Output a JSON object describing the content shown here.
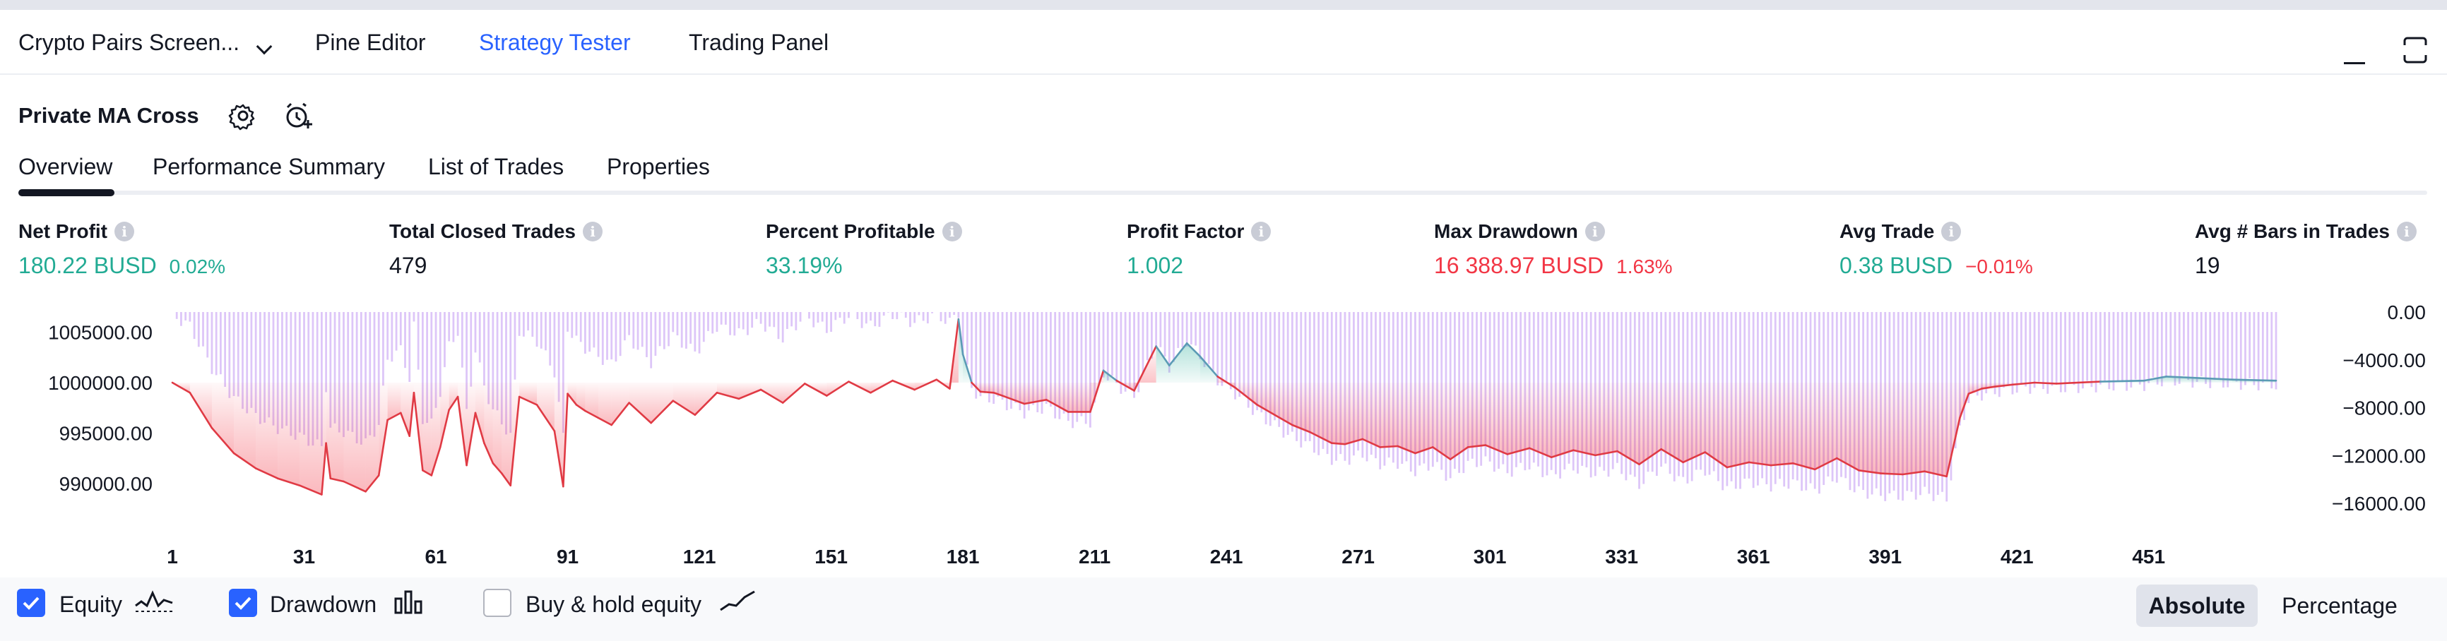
{
  "panel_tabs": [
    "Crypto Pairs Screen...",
    "Pine Editor",
    "Strategy Tester",
    "Trading Panel"
  ],
  "strategy": {
    "name": "Private MA Cross"
  },
  "subtabs": [
    "Overview",
    "Performance Summary",
    "List of Trades",
    "Properties"
  ],
  "metrics": [
    {
      "label": "Net Profit",
      "value": "180.22 BUSD",
      "sub": "0.02%",
      "color": "#22ab94",
      "sub_color": "#22ab94"
    },
    {
      "label": "Total Closed Trades",
      "value": "479",
      "sub": "",
      "color": "#131722",
      "sub_color": "#131722"
    },
    {
      "label": "Percent Profitable",
      "value": "33.19%",
      "sub": "",
      "color": "#22ab94",
      "sub_color": "#22ab94"
    },
    {
      "label": "Profit Factor",
      "value": "1.002",
      "sub": "",
      "color": "#22ab94",
      "sub_color": "#22ab94"
    },
    {
      "label": "Max Drawdown",
      "value": "16 388.97 BUSD",
      "sub": "1.63%",
      "color": "#f23645",
      "sub_color": "#f23645"
    },
    {
      "label": "Avg Trade",
      "value": "0.38 BUSD",
      "sub": "−0.01%",
      "color": "#22ab94",
      "sub_color": "#f23645"
    },
    {
      "label": "Avg # Bars in Trades",
      "value": "19",
      "sub": "",
      "color": "#131722",
      "sub_color": "#131722"
    }
  ],
  "chart_data": {
    "type": "line",
    "x_tick_labels": [
      "1",
      "31",
      "61",
      "91",
      "121",
      "151",
      "181",
      "211",
      "241",
      "271",
      "301",
      "331",
      "361",
      "391",
      "421",
      "451"
    ],
    "y_left_tick_labels": [
      "1005000.00",
      "1000000.00",
      "995000.00",
      "990000.00"
    ],
    "y_right_tick_labels": [
      "0.00",
      "−4000.00",
      "−8000.00",
      "−12000.00",
      "−16000.00"
    ],
    "y_left_range": [
      986000,
      1007000
    ],
    "y_right_range": [
      -17700,
      0
    ],
    "baseline_equity": 1000000,
    "series": [
      {
        "name": "Equity",
        "x": [
          1,
          5,
          10,
          15,
          20,
          25,
          30,
          35,
          36,
          37,
          40,
          45,
          48,
          50,
          53,
          55,
          56,
          58,
          60,
          62,
          64,
          66,
          68,
          70,
          72,
          74,
          76,
          78,
          80,
          84,
          88,
          90,
          91,
          93,
          95,
          98,
          101,
          105,
          110,
          115,
          120,
          125,
          130,
          135,
          140,
          145,
          150,
          155,
          160,
          165,
          170,
          175,
          178,
          180,
          181,
          183,
          185,
          188,
          190,
          195,
          200,
          205,
          210,
          213,
          216,
          220,
          225,
          228,
          232,
          235,
          239,
          243,
          248,
          252,
          256,
          260,
          265,
          268,
          272,
          276,
          280,
          284,
          288,
          292,
          296,
          300,
          305,
          310,
          315,
          320,
          325,
          330,
          335,
          340,
          345,
          350,
          355,
          360,
          365,
          370,
          375,
          380,
          385,
          390,
          395,
          400,
          405,
          408,
          410,
          413,
          416,
          420,
          425,
          430,
          440,
          450,
          455,
          460,
          470,
          480
        ],
        "values": [
          1000000,
          999000,
          995500,
          993000,
          991500,
          990500,
          989800,
          988900,
          994000,
          990500,
          990200,
          989200,
          990800,
          996300,
          997000,
          994700,
          999000,
          991300,
          990800,
          993600,
          997300,
          998600,
          991800,
          997000,
          994000,
          992000,
          991000,
          989800,
          998600,
          997800,
          995200,
          989700,
          998900,
          997800,
          997200,
          996500,
          995800,
          998000,
          996000,
          998200,
          996800,
          999000,
          998400,
          999300,
          998000,
          999900,
          998700,
          1000100,
          999000,
          1000200,
          999300,
          1000300,
          999400,
          1006300,
          1002800,
          1000000,
          999100,
          999000,
          998700,
          997900,
          998300,
          997100,
          997100,
          1001200,
          1000200,
          999200,
          1003600,
          1001700,
          1003900,
          1002600,
          1000600,
          999500,
          997800,
          996800,
          995800,
          995100,
          994000,
          993900,
          994400,
          993600,
          993700,
          993000,
          993600,
          992400,
          993600,
          993800,
          992900,
          993500,
          992600,
          993300,
          992800,
          993200,
          991900,
          993400,
          992100,
          993100,
          991600,
          992100,
          991800,
          992000,
          991400,
          992500,
          991300,
          991000,
          990900,
          991200,
          990700,
          996500,
          998900,
          999400,
          999600,
          999800,
          1000000,
          999900,
          1000100,
          1000200,
          1000600,
          1000500,
          1000300,
          1000200
        ]
      },
      {
        "name": "Drawdown",
        "x": [
          1,
          5,
          10,
          15,
          20,
          25,
          30,
          35,
          36,
          37,
          40,
          45,
          48,
          50,
          53,
          55,
          56,
          58,
          60,
          62,
          64,
          66,
          68,
          70,
          72,
          74,
          76,
          78,
          80,
          84,
          88,
          90,
          91,
          93,
          95,
          98,
          101,
          105,
          110,
          115,
          120,
          125,
          130,
          135,
          140,
          145,
          150,
          155,
          160,
          165,
          170,
          175,
          178,
          180,
          181,
          183,
          185,
          188,
          190,
          195,
          200,
          205,
          210,
          213,
          216,
          220,
          225,
          228,
          232,
          235,
          239,
          243,
          248,
          252,
          256,
          260,
          265,
          268,
          272,
          276,
          280,
          284,
          288,
          292,
          296,
          300,
          305,
          310,
          315,
          320,
          325,
          330,
          335,
          340,
          345,
          350,
          355,
          360,
          365,
          370,
          375,
          380,
          385,
          390,
          395,
          400,
          405,
          408,
          410,
          413,
          416,
          420,
          425,
          430,
          440,
          450,
          455,
          460,
          470,
          480
        ],
        "values": [
          -200,
          -1200,
          -4700,
          -7200,
          -8700,
          -9700,
          -10400,
          -11300,
          -6200,
          -9700,
          -10000,
          -11000,
          -9400,
          -3900,
          -3200,
          -5500,
          -1200,
          -8900,
          -9400,
          -6600,
          -2900,
          -1600,
          -8400,
          -3200,
          -6200,
          -8200,
          -9200,
          -10400,
          -1600,
          -2400,
          -5000,
          -10500,
          -1300,
          -2400,
          -3000,
          -3700,
          -4400,
          -2200,
          -4200,
          -2000,
          -3400,
          -1200,
          -1800,
          -900,
          -2200,
          -300,
          -1500,
          -300,
          -1200,
          -200,
          -900,
          -200,
          -900,
          0,
          -3500,
          -6300,
          -7200,
          -7300,
          -7600,
          -8400,
          -8000,
          -9200,
          -9200,
          -5100,
          -6100,
          -7100,
          -2700,
          -4600,
          -2400,
          -3700,
          -5700,
          -6800,
          -8500,
          -9500,
          -10500,
          -11200,
          -12300,
          -12400,
          -11900,
          -12700,
          -12600,
          -13300,
          -12700,
          -13900,
          -12700,
          -12500,
          -13400,
          -12800,
          -13700,
          -13000,
          -13500,
          -13100,
          -14400,
          -12900,
          -14200,
          -13200,
          -14700,
          -14200,
          -14500,
          -14300,
          -14900,
          -13800,
          -15000,
          -15300,
          -15400,
          -15100,
          -15600,
          -9800,
          -7400,
          -6900,
          -6700,
          -6500,
          -6300,
          -6400,
          -6200,
          -6100,
          -5700,
          -5800,
          -6000,
          -6100
        ]
      }
    ]
  },
  "legend": {
    "equity": {
      "label": "Equity",
      "checked": true
    },
    "drawdown": {
      "label": "Drawdown",
      "checked": true
    },
    "buy_hold": {
      "label": "Buy & hold equity",
      "checked": false
    }
  },
  "view_mode": {
    "options": [
      "Absolute",
      "Percentage"
    ],
    "selected": "Absolute"
  },
  "colors": {
    "accent": "#2962ff",
    "profit": "#22ab94",
    "loss": "#f23645",
    "drawdown_bar": "#d1b3f5",
    "equity_line_pos": "#5b9bb5",
    "equity_line_neg": "#e03a44"
  }
}
